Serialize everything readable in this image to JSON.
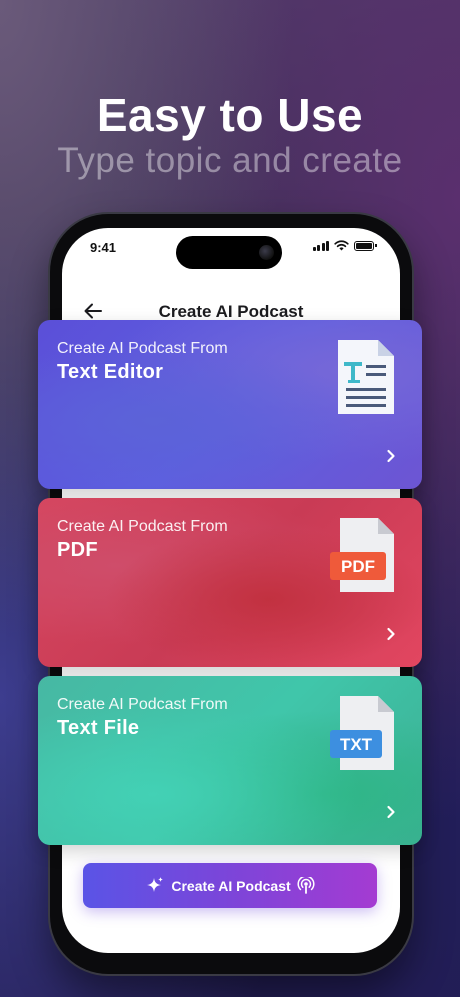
{
  "promo": {
    "headline": "Easy to Use",
    "subheadline": "Type topic and create"
  },
  "status_bar": {
    "time": "9:41"
  },
  "nav": {
    "title": "Create AI Podcast"
  },
  "cards": [
    {
      "eyebrow": "Create AI Podcast From",
      "title": "Text Editor",
      "icon": "text-editor-document-icon"
    },
    {
      "eyebrow": "Create AI Podcast From",
      "title": "PDF",
      "icon": "pdf-document-icon",
      "badge": "PDF"
    },
    {
      "eyebrow": "Create AI Podcast From",
      "title": "Text File",
      "icon": "txt-document-icon",
      "badge": "TXT"
    }
  ],
  "cta": {
    "label": "Create AI Podcast"
  },
  "colors": {
    "text_editor_card": "#5d5fe0",
    "pdf_card": "#d6465f",
    "text_file_card": "#40c6aa",
    "cta_start": "#5a54e6",
    "cta_end": "#a43bd2"
  }
}
